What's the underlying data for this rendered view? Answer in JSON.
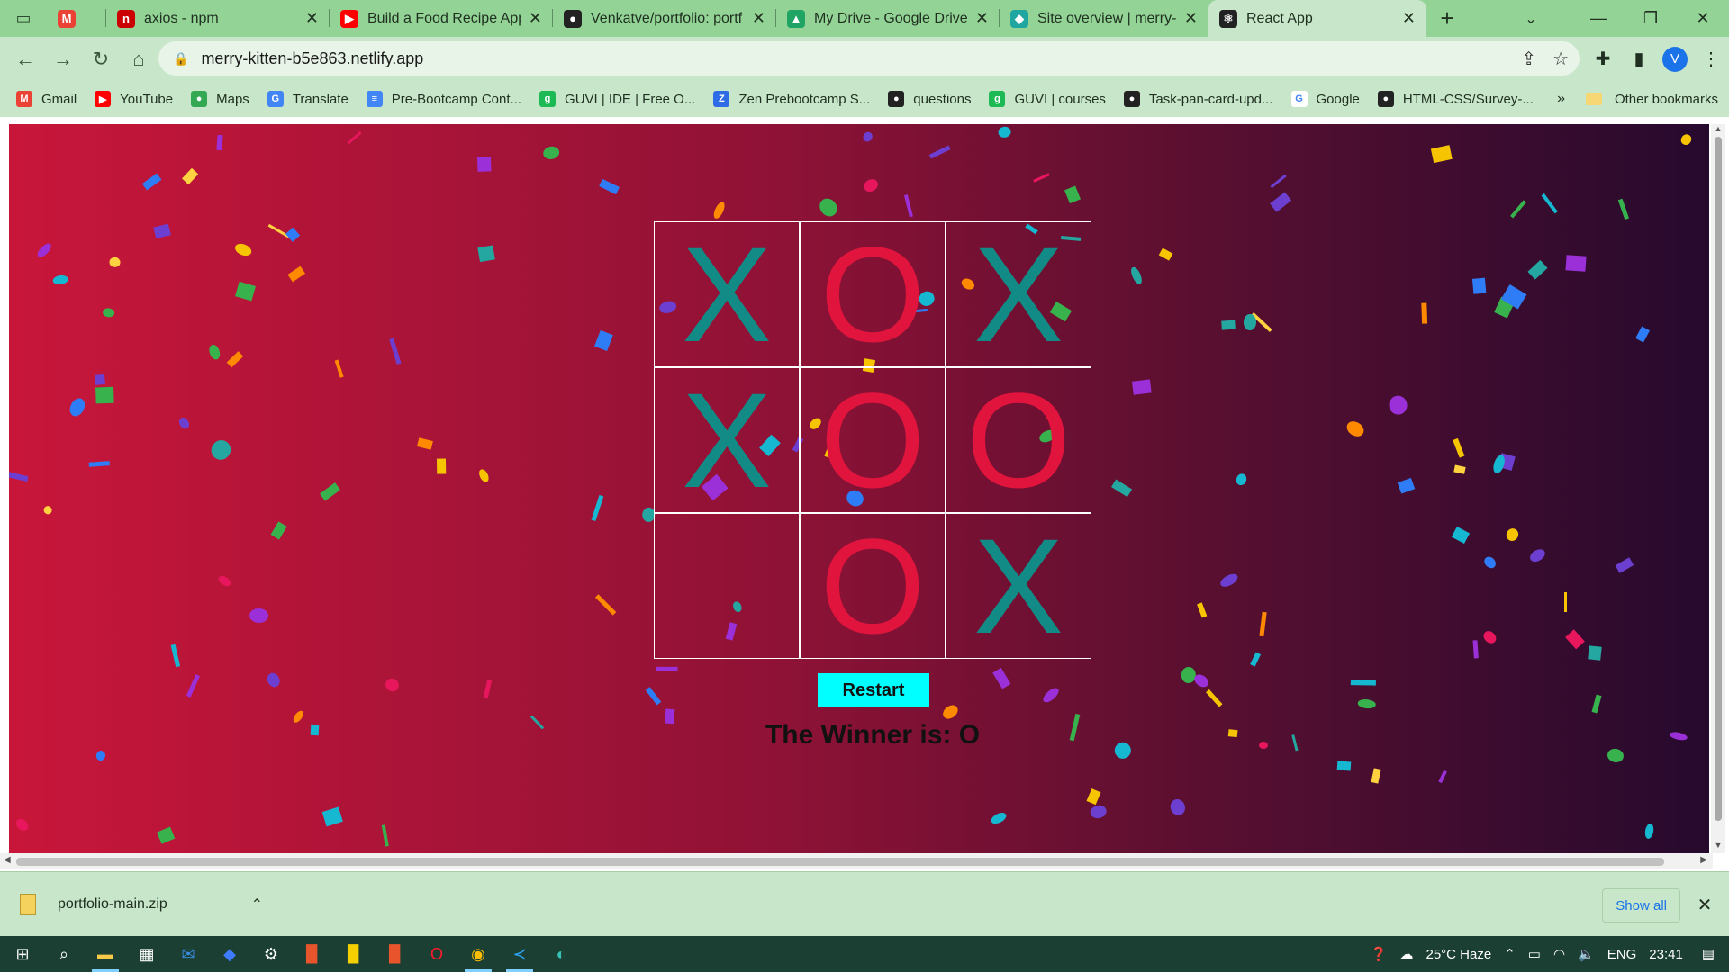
{
  "browser": {
    "tabs": [
      {
        "title": "axios - npm",
        "favicon": "npm-icon",
        "color": "#cb0000",
        "glyph": "n",
        "active": false
      },
      {
        "title": "Build a Food Recipe App",
        "favicon": "youtube-icon",
        "color": "#ff0000",
        "glyph": "▶",
        "active": false
      },
      {
        "title": "Venkatve/portfolio: portf",
        "favicon": "github-icon",
        "color": "#222222",
        "glyph": "●",
        "active": false
      },
      {
        "title": "My Drive - Google Drive",
        "favicon": "google-drive-icon",
        "color": "#1fa463",
        "glyph": "▲",
        "active": false
      },
      {
        "title": "Site overview | merry-kitt",
        "favicon": "netlify-icon",
        "color": "#20a6a0",
        "glyph": "◆",
        "active": false
      },
      {
        "title": "React App",
        "favicon": "react-icon",
        "color": "#222222",
        "glyph": "⚛",
        "active": true
      }
    ],
    "address": {
      "url": "merry-kitten-b5e863.netlify.app"
    },
    "profile_initial": "V",
    "bookmarks": [
      {
        "label": "Gmail",
        "icon": "gmail-icon",
        "color": "#ea4335",
        "glyph": "M"
      },
      {
        "label": "YouTube",
        "icon": "youtube-icon",
        "color": "#ff0000",
        "glyph": "▶"
      },
      {
        "label": "Maps",
        "icon": "maps-icon",
        "color": "#34a853",
        "glyph": "●"
      },
      {
        "label": "Translate",
        "icon": "translate-icon",
        "color": "#4285f4",
        "glyph": "G"
      },
      {
        "label": "Pre-Bootcamp Cont...",
        "icon": "docs-icon",
        "color": "#4285f4",
        "glyph": "≡"
      },
      {
        "label": "GUVI | IDE | Free O...",
        "icon": "guvi-icon",
        "color": "#1db954",
        "glyph": "g"
      },
      {
        "label": "Zen Prebootcamp S...",
        "icon": "zen-icon",
        "color": "#2e6be6",
        "glyph": "Z"
      },
      {
        "label": "questions",
        "icon": "github-icon",
        "color": "#222222",
        "glyph": "●"
      },
      {
        "label": "GUVI | courses",
        "icon": "guvi-icon",
        "color": "#1db954",
        "glyph": "g"
      },
      {
        "label": "Task-pan-card-upd...",
        "icon": "github-icon",
        "color": "#222222",
        "glyph": "●"
      },
      {
        "label": "Google",
        "icon": "google-icon",
        "color": "#ffffff",
        "glyph": "G"
      },
      {
        "label": "HTML-CSS/Survey-...",
        "icon": "github-icon",
        "color": "#222222",
        "glyph": "●"
      }
    ],
    "bookmarks_more": "»",
    "other_bookmarks": "Other bookmarks"
  },
  "game": {
    "cells": [
      "X",
      "O",
      "X",
      "X",
      "O",
      "O",
      "",
      "O",
      "X"
    ],
    "restart_label": "Restart",
    "winner_text": "The Winner is: O",
    "colors": {
      "x": "#128a85",
      "o": "#e0143c",
      "restart_bg": "#00ffff"
    }
  },
  "downloads": {
    "file": "portfolio-main.zip",
    "show_all": "Show all"
  },
  "taskbar": {
    "weather": "25°C  Haze",
    "language": "ENG",
    "time": "23:41"
  }
}
